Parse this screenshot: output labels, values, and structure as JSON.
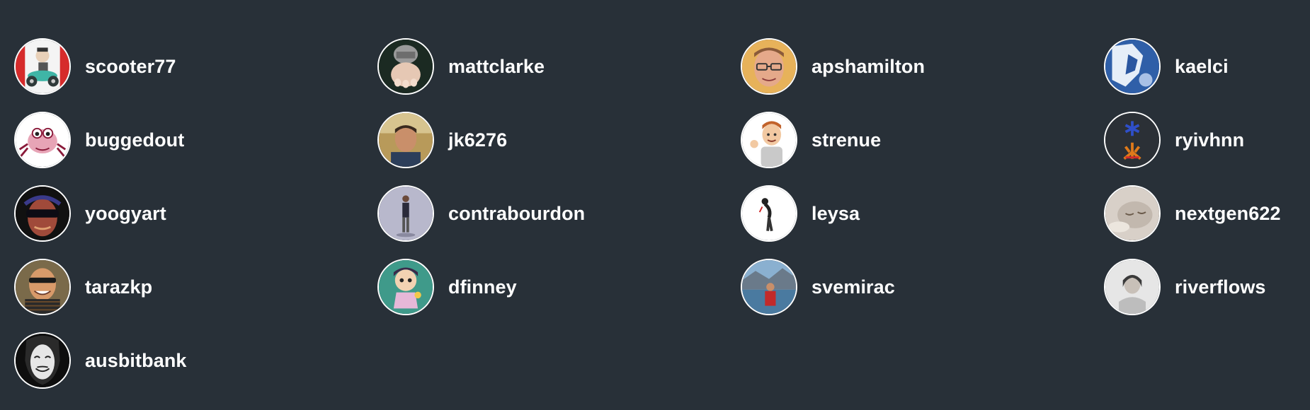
{
  "users": [
    {
      "username": "scooter77",
      "avatar": "scooter-cartoon-avatar"
    },
    {
      "username": "mattclarke",
      "avatar": "robot-foot-avatar"
    },
    {
      "username": "apshamilton",
      "avatar": "man-with-glasses-avatar"
    },
    {
      "username": "kaelci",
      "avatar": "blue-portrait-avatar"
    },
    {
      "username": "buggedout",
      "avatar": "bug-cartoon-avatar"
    },
    {
      "username": "jk6276",
      "avatar": "man-photo-avatar"
    },
    {
      "username": "strenue",
      "avatar": "cartoon-man-avatar"
    },
    {
      "username": "ryivhnn",
      "avatar": "kanji-characters-avatar"
    },
    {
      "username": "yoogyart",
      "avatar": "sunglasses-man-avatar"
    },
    {
      "username": "contrabourdon",
      "avatar": "standing-person-avatar"
    },
    {
      "username": "leysa",
      "avatar": "leaning-person-avatar"
    },
    {
      "username": "nextgen622",
      "avatar": "sleeping-baby-avatar"
    },
    {
      "username": "tarazkp",
      "avatar": "smiling-man-sunglasses-avatar"
    },
    {
      "username": "dfinney",
      "avatar": "animal-crossing-avatar"
    },
    {
      "username": "svemirac",
      "avatar": "person-by-lake-avatar"
    },
    {
      "username": "riverflows",
      "avatar": "woman-portrait-avatar"
    },
    {
      "username": "ausbitbank",
      "avatar": "masked-face-avatar"
    }
  ]
}
